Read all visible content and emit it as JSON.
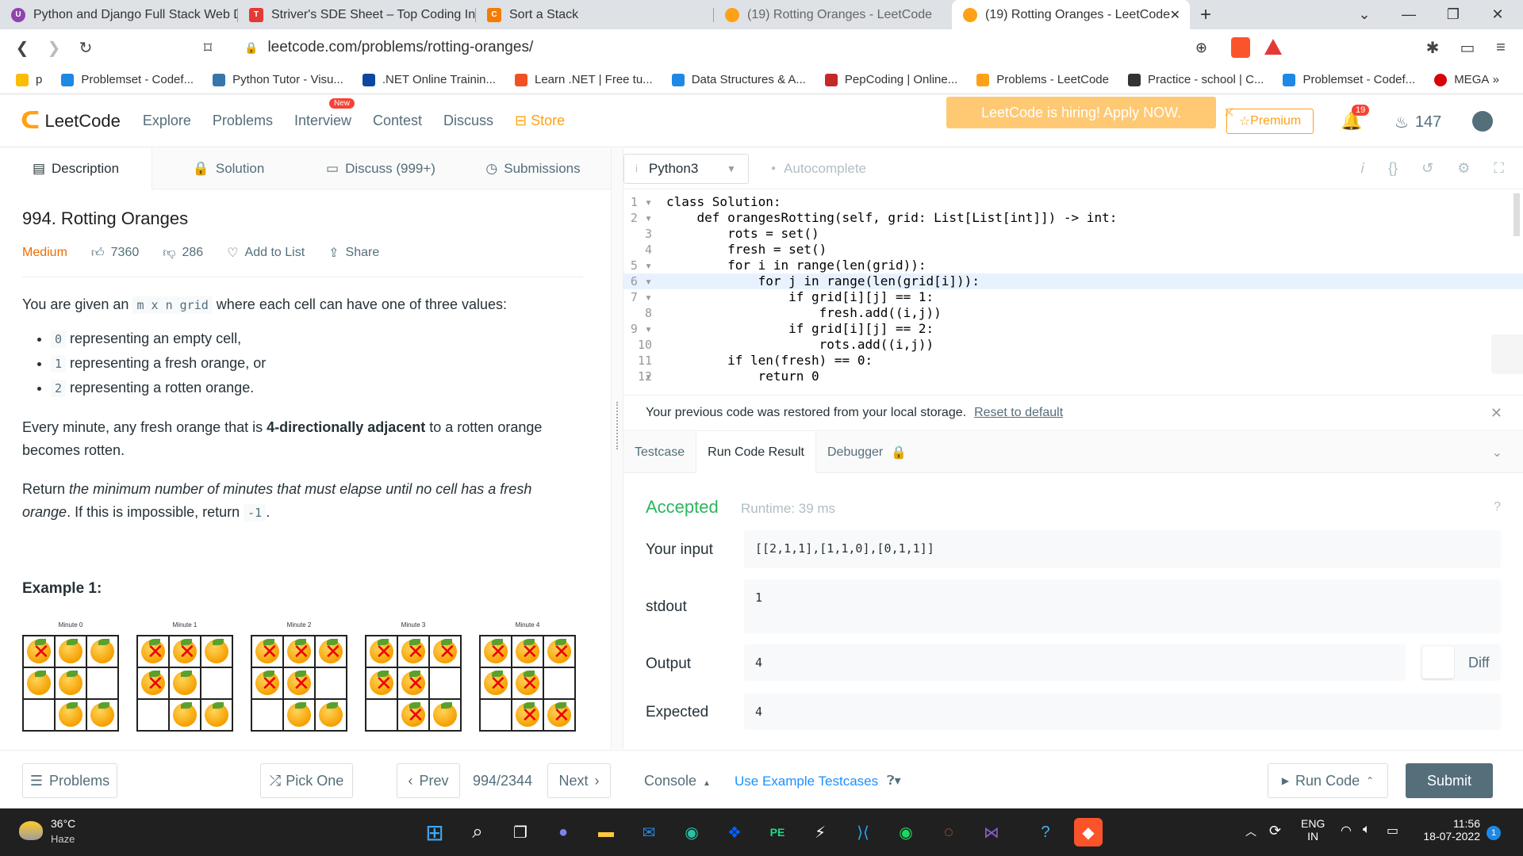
{
  "browser": {
    "tabs": [
      {
        "title": "Python and Django Full Stack Web De",
        "color": "#8e44ad"
      },
      {
        "title": "Striver's SDE Sheet – Top Coding Inter",
        "color": "#e53935"
      },
      {
        "title": "Sort a Stack",
        "color": "#f57c00"
      },
      {
        "title": "(19) Rotting Oranges - LeetCode",
        "color": "#ffa116"
      },
      {
        "title": "(19) Rotting Oranges - LeetCode",
        "color": "#ffa116"
      }
    ],
    "url": "leetcode.com/problems/rotting-oranges/",
    "bookmarks": [
      {
        "label": "p",
        "color": "#fbbc04"
      },
      {
        "label": "Problemset - Codef...",
        "color": "#1e88e5"
      },
      {
        "label": "Python Tutor - Visu...",
        "color": "#3776ab"
      },
      {
        "label": ".NET Online Trainin...",
        "color": "#0d47a1"
      },
      {
        "label": "Learn .NET | Free tu...",
        "color": "#f25022"
      },
      {
        "label": "Data Structures & A...",
        "color": "#1e88e5"
      },
      {
        "label": "PepCoding | Online...",
        "color": "#c62828"
      },
      {
        "label": "Problems - LeetCode",
        "color": "#ffa116"
      },
      {
        "label": "Practice - school | C...",
        "color": "#333333"
      },
      {
        "label": "Problemset - Codef...",
        "color": "#1e88e5"
      },
      {
        "label": "MEGA",
        "color": "#d90007"
      }
    ]
  },
  "leetcode_nav": {
    "logo": "LeetCode",
    "links": [
      "Explore",
      "Problems",
      "Interview",
      "Contest",
      "Discuss"
    ],
    "new_badge": "New",
    "store": "Store",
    "hiring": "LeetCode is hiring! Apply NOW.",
    "premium": "Premium",
    "notifications": "19",
    "streak": "147"
  },
  "left_tabs": [
    "Description",
    "Solution",
    "Discuss (999+)",
    "Submissions"
  ],
  "problem": {
    "title": "994. Rotting Oranges",
    "difficulty": "Medium",
    "likes": "7360",
    "dislikes": "286",
    "add_to_list": "Add to List",
    "share": "Share",
    "intro_a": "You are given an",
    "intro_code": "m x n grid",
    "intro_b": "where each cell can have one of three values:",
    "values": [
      {
        "code": "0",
        "text": "representing an empty cell,"
      },
      {
        "code": "1",
        "text": "representing a fresh orange, or"
      },
      {
        "code": "2",
        "text": "representing a rotten orange."
      }
    ],
    "p2_a": "Every minute, any fresh orange that is",
    "p2_bold": "4-directionally adjacent",
    "p2_b": "to a rotten orange becomes rotten.",
    "p3_a": "Return",
    "p3_italic": "the minimum number of minutes that must elapse until no cell has a fresh orange",
    "p3_b": ". If this is impossible, return",
    "p3_code": "-1",
    "p3_c": ".",
    "example_title": "Example 1:",
    "minutes": [
      "Minute 0",
      "Minute 1",
      "Minute 2",
      "Minute 3",
      "Minute 4"
    ]
  },
  "editor": {
    "language": "Python3",
    "autocomplete": "Autocomplete",
    "lines": [
      "class Solution:",
      "    def orangesRotting(self, grid: List[List[int]]) -> int:",
      "        rots = set()",
      "        fresh = set()",
      "        for i in range(len(grid)):",
      "            for j in range(len(grid[i])):",
      "                if grid[i][j] == 1:",
      "                    fresh.add((i,j))",
      "                if grid[i][j] == 2:",
      "                    rots.add((i,j))",
      "        if len(fresh) == 0:",
      "            return 0"
    ]
  },
  "restore_msg": "Your previous code was restored from your local storage.",
  "reset_link": "Reset to default",
  "result_tabs": [
    "Testcase",
    "Run Code Result",
    "Debugger"
  ],
  "result": {
    "status": "Accepted",
    "runtime": "Runtime: 39 ms",
    "input_label": "Your input",
    "input": "[[2,1,1],[1,1,0],[0,1,1]]",
    "stdout_label": "stdout",
    "stdout": "1",
    "output_label": "Output",
    "output": "4",
    "diff": "Diff",
    "expected_label": "Expected",
    "expected": "4"
  },
  "bottom": {
    "problems": "Problems",
    "pick_one": "Pick One",
    "prev": "Prev",
    "counter": "994/2344",
    "next": "Next",
    "console": "Console",
    "use_example": "Use Example Testcases",
    "run_code": "Run Code",
    "submit": "Submit"
  },
  "taskbar": {
    "temp": "36°C",
    "weather": "Haze",
    "lang1": "ENG",
    "lang2": "IN",
    "time": "11:56",
    "date": "18-07-2022"
  }
}
